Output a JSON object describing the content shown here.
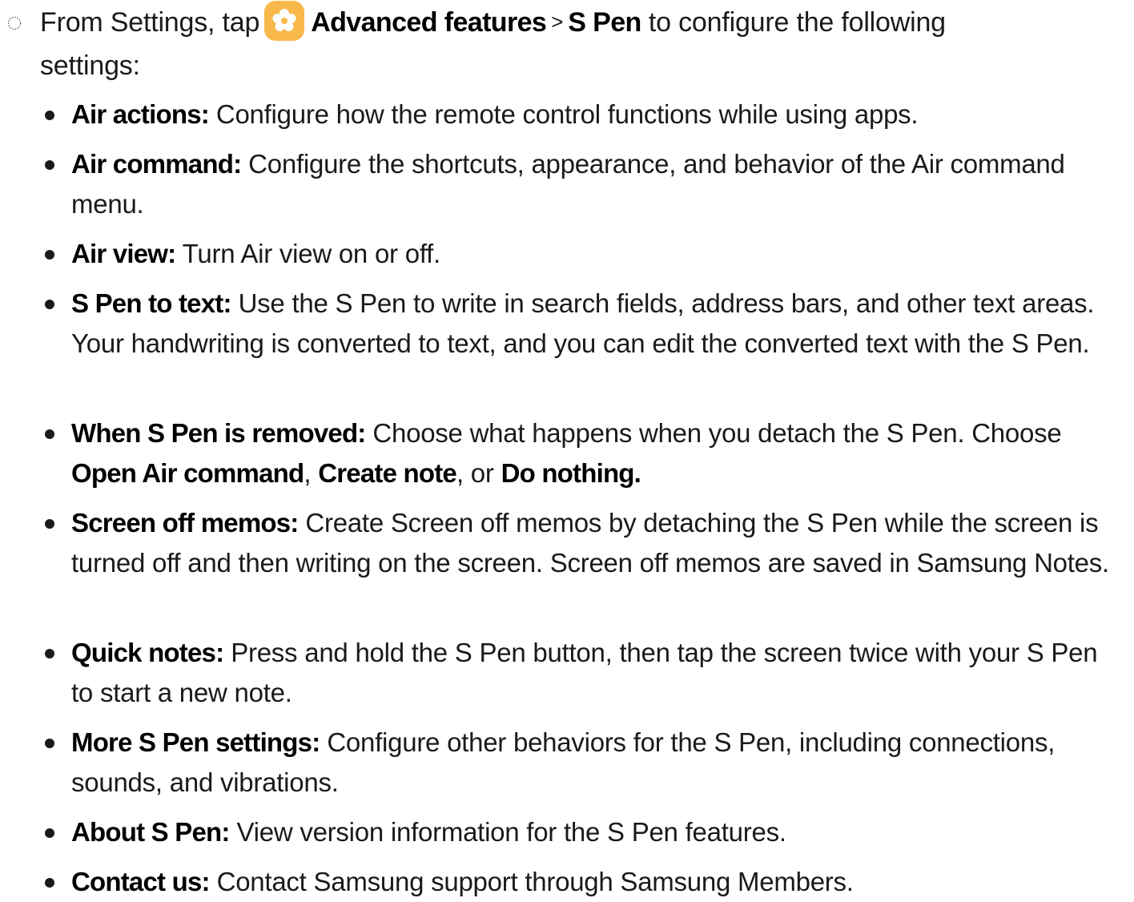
{
  "intro": {
    "prefix": "From Settings, tap",
    "icon": "settings-gear-icon",
    "icon_color": "#F9B84A",
    "path_1": "Advanced features",
    "separator": ">",
    "path_2": "S Pen",
    "suffix": " to configure the following",
    "line2": "settings:"
  },
  "items": [
    {
      "label": "Air actions:",
      "desc": " Configure how the remote control functions while using apps."
    },
    {
      "label": "Air command:",
      "desc": " Configure the shortcuts, appearance, and behavior of the Air command menu."
    },
    {
      "label": "Air view:",
      "desc": " Turn Air view on or off."
    },
    {
      "label": "S Pen to text:",
      "desc": " Use the S Pen to write in search fields, address bars, and other text areas. Your handwriting is converted to text, and you can edit the converted text with the S Pen."
    },
    {
      "label": "When S Pen is removed:",
      "desc": " Choose what happens when you detach the S Pen. Choose ",
      "opt1": "Open Air command",
      "comma": ", ",
      "opt2": "Create note",
      "or": ", or ",
      "opt3": "Do nothing",
      "end": "."
    },
    {
      "label": "Screen off memos:",
      "desc": " Create Screen off memos by detaching the S Pen while the screen is turned off and then writing on the screen. Screen off memos are saved in Samsung Notes."
    },
    {
      "label": "Quick notes:",
      "desc": " Press and hold the S Pen button, then tap the screen twice with your S Pen to start a new note."
    },
    {
      "label": "More S Pen settings:",
      "desc": " Configure other behaviors for the S Pen, including connections, sounds, and vibrations."
    },
    {
      "label": "About S Pen:",
      "desc": " View version information for the S Pen features."
    },
    {
      "label": "Contact us:",
      "desc": " Contact Samsung support through Samsung Members."
    }
  ]
}
